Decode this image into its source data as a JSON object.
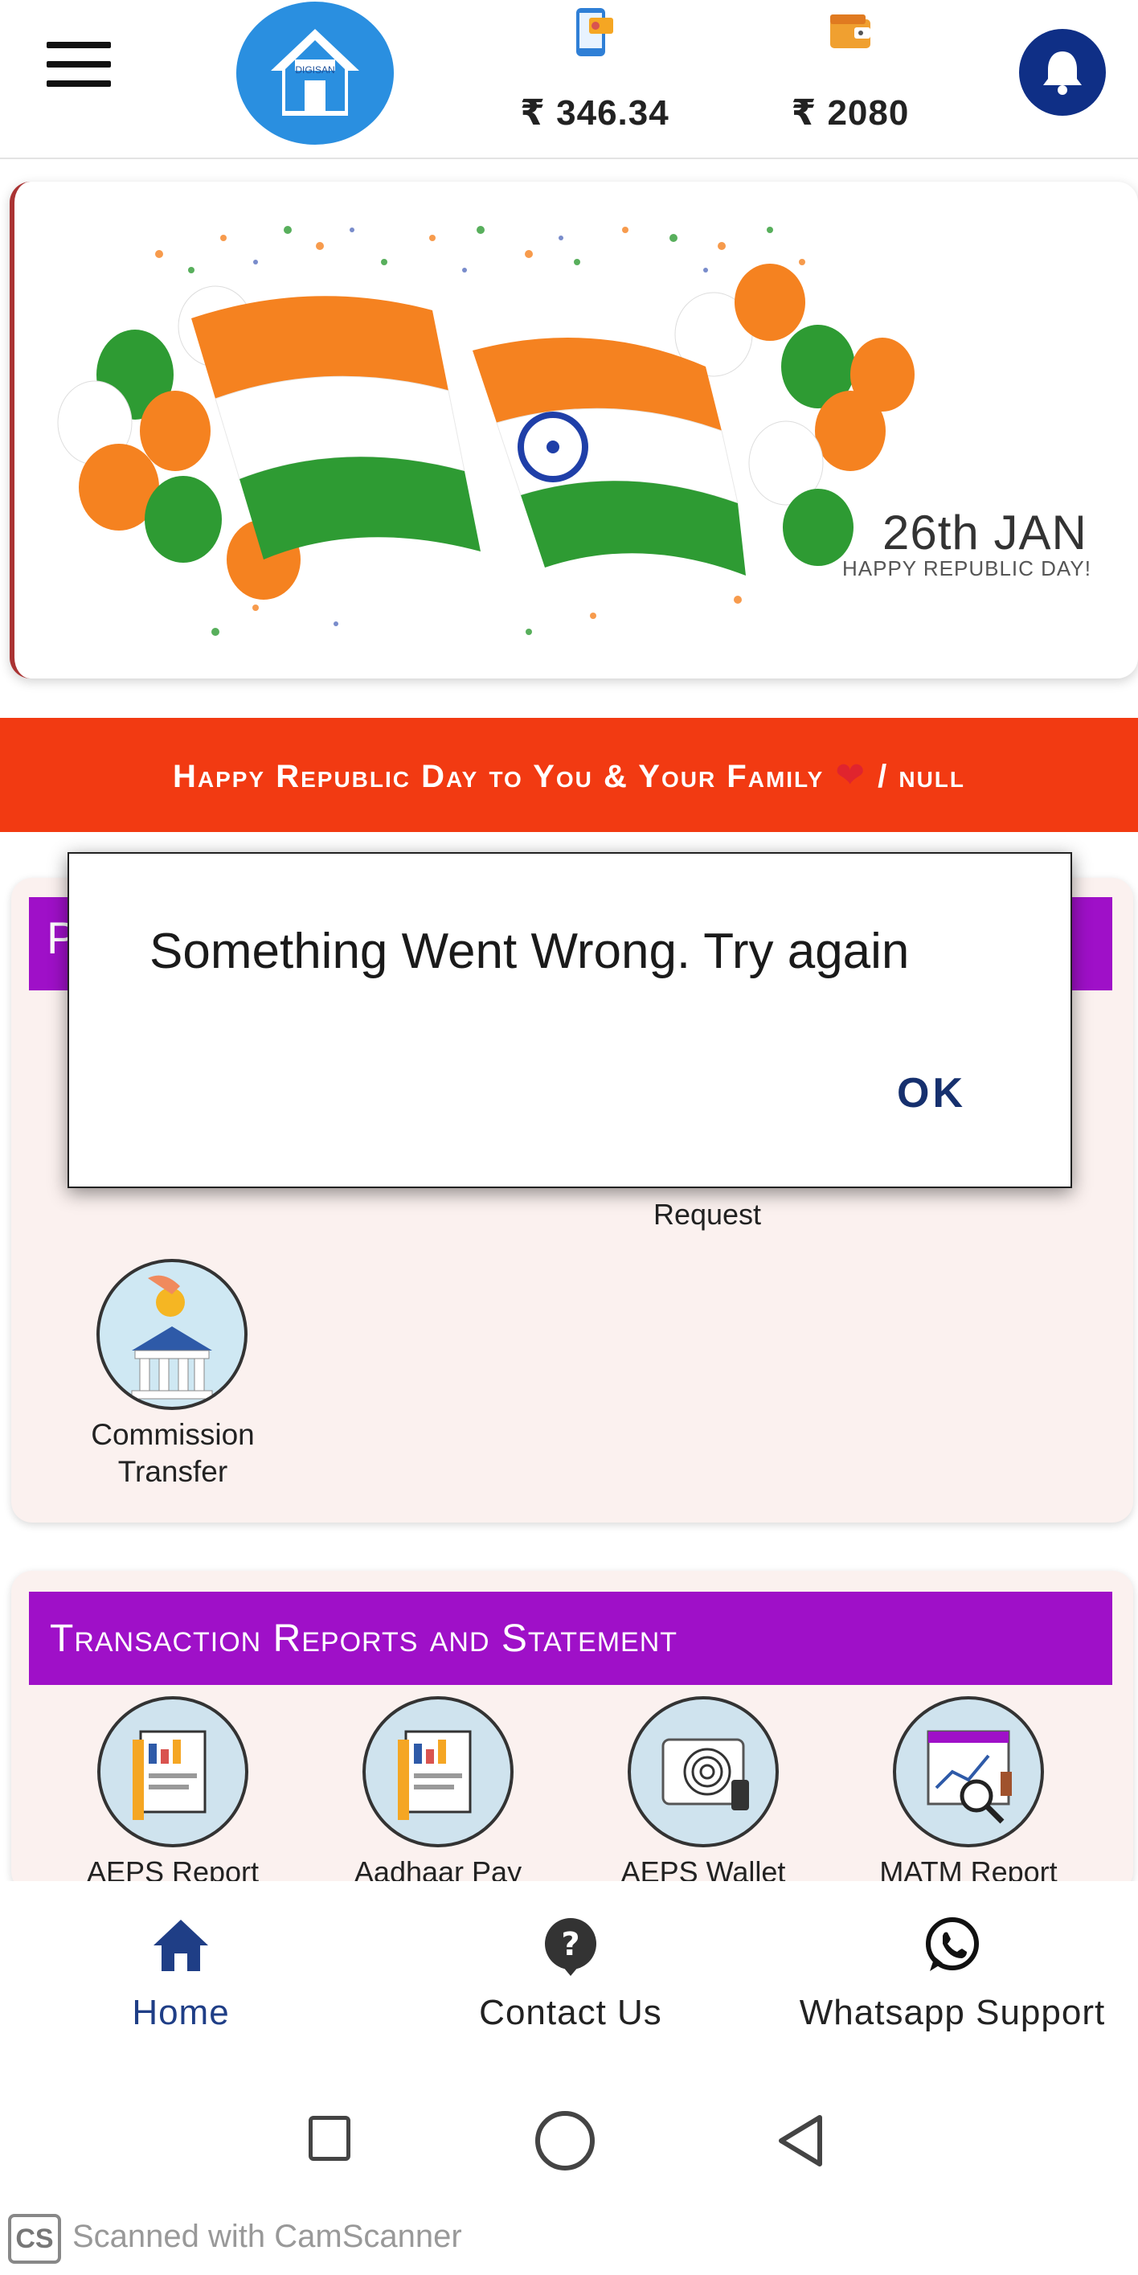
{
  "header": {
    "menu_icon": "hamburger-menu-icon",
    "logo_text": "DIGISAN",
    "wallet_main": {
      "icon": "mobile-wallet-icon",
      "amount": "₹ 346.34"
    },
    "wallet_aeps": {
      "icon": "wallet-icon",
      "amount": "₹ 2080"
    },
    "notification_icon": "bell-icon"
  },
  "banner": {
    "date_text": "26th JAN",
    "sub_text": "HAPPY REPUBLIC DAY!",
    "colors": {
      "saffron": "#f58220",
      "white": "#ffffff",
      "green": "#2e9b33",
      "chakra": "#1f3fa8"
    }
  },
  "ticker": {
    "text_before": "Happy Republic Day to You & Your Family",
    "text_after": "/ null",
    "heart": "❤"
  },
  "section1": {
    "title_visible_letter": "P",
    "partial_label": "Request",
    "commission": {
      "label_line1": "Commission",
      "label_line2": "Transfer"
    }
  },
  "section2": {
    "title": "Transaction Reports and Statement",
    "items": [
      {
        "label": "AEPS Report"
      },
      {
        "label": "Aadhaar Pay"
      },
      {
        "label": "AEPS Wallet"
      },
      {
        "label": "MATM Report"
      }
    ]
  },
  "bottom_nav": {
    "items": [
      {
        "label": "Home",
        "icon": "home-icon"
      },
      {
        "label": "Contact Us",
        "icon": "help-icon"
      },
      {
        "label": "Whatsapp Support",
        "icon": "whatsapp-icon"
      }
    ]
  },
  "dialog": {
    "message": "Something Went Wrong. Try again",
    "ok_label": "OK"
  },
  "watermark": {
    "logo": "CS",
    "text": "Scanned with CamScanner"
  },
  "colors": {
    "purple": "#9f10c8",
    "ticker_red": "#f23a12",
    "navy": "#1f3e86",
    "logo_blue": "#2a8fe0"
  }
}
